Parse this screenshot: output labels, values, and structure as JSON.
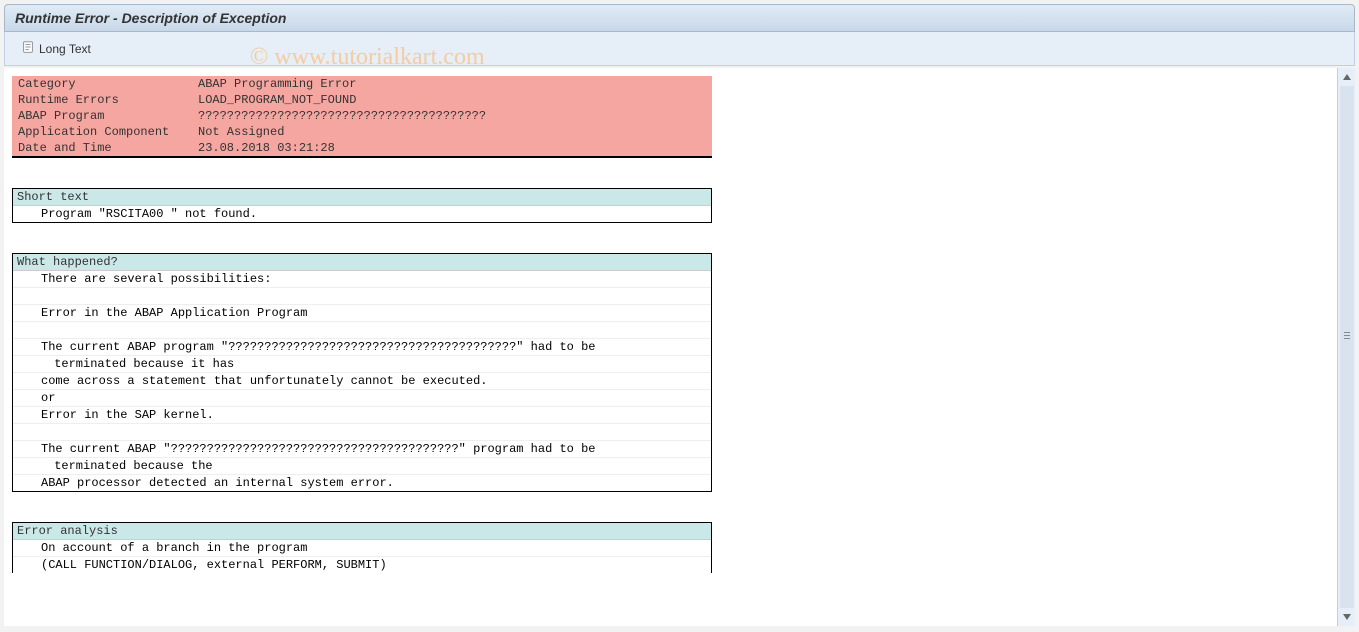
{
  "title": "Runtime Error - Description of Exception",
  "toolbar": {
    "long_text_label": "Long Text"
  },
  "summary": {
    "rows": [
      {
        "label": "Category",
        "value": "ABAP Programming Error"
      },
      {
        "label": "Runtime Errors",
        "value": "LOAD_PROGRAM_NOT_FOUND"
      },
      {
        "label": "ABAP Program",
        "value": "????????????????????????????????????????"
      },
      {
        "label": "Application Component",
        "value": "Not Assigned"
      },
      {
        "label": "Date and Time",
        "value": "23.08.2018 03:21:28"
      }
    ]
  },
  "short_text": {
    "header": "Short text",
    "lines": [
      "Program \"RSCITA00 \" not found."
    ]
  },
  "what_happened": {
    "header": "What happened?",
    "lines": [
      "There are several possibilities:",
      "",
      "Error in the ABAP Application Program",
      "",
      "The current ABAP program \"????????????????????????????????????????\" had to be",
      " terminated because it has",
      "come across a statement that unfortunately cannot be executed.",
      "or",
      "Error in the SAP kernel.",
      "",
      "The current ABAP \"????????????????????????????????????????\" program had to be",
      " terminated because the",
      "ABAP processor detected an internal system error."
    ]
  },
  "error_analysis": {
    "header": "Error analysis",
    "lines": [
      "On account of a branch in the program",
      "(CALL FUNCTION/DIALOG, external PERFORM, SUBMIT)"
    ]
  },
  "watermark": "© www.tutorialkart.com"
}
